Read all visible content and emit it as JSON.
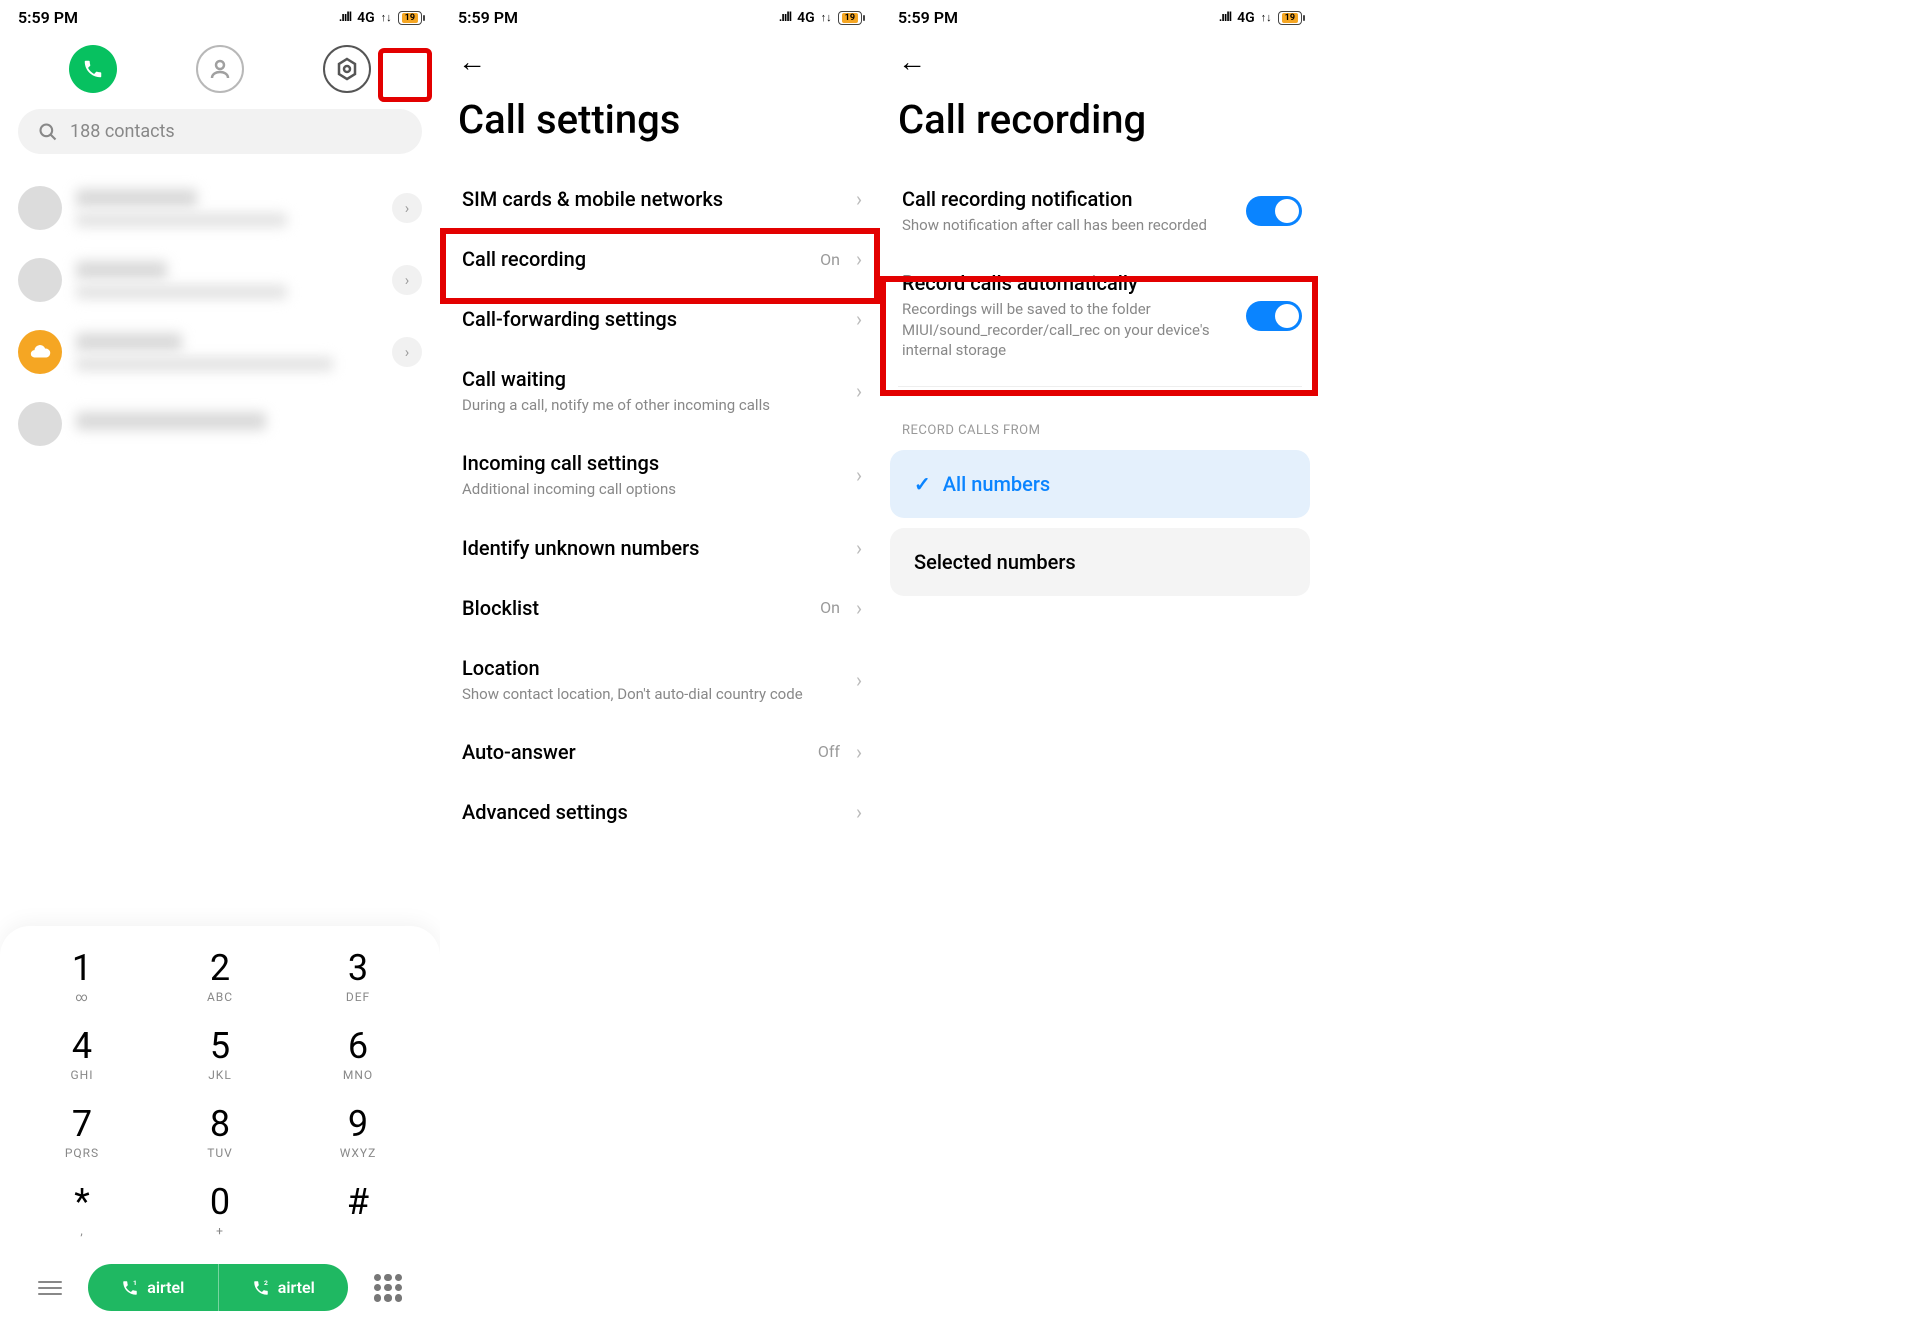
{
  "status": {
    "time": "5:59 PM",
    "network": "4G",
    "battery_pct": "19"
  },
  "screen1": {
    "search_placeholder": "188 contacts",
    "dialpad": [
      {
        "num": "1",
        "let": "∞"
      },
      {
        "num": "2",
        "let": "ABC"
      },
      {
        "num": "3",
        "let": "DEF"
      },
      {
        "num": "4",
        "let": "GHI"
      },
      {
        "num": "5",
        "let": "JKL"
      },
      {
        "num": "6",
        "let": "MNO"
      },
      {
        "num": "7",
        "let": "PQRS"
      },
      {
        "num": "8",
        "let": "TUV"
      },
      {
        "num": "9",
        "let": "WXYZ"
      },
      {
        "num": "*",
        "let": ","
      },
      {
        "num": "0",
        "let": "+"
      },
      {
        "num": "#",
        "let": ""
      }
    ],
    "sim1": "airtel",
    "sim2": "airtel"
  },
  "screen2": {
    "title": "Call settings",
    "items": [
      {
        "title": "SIM cards & mobile networks",
        "desc": "",
        "val": ""
      },
      {
        "title": "Call recording",
        "desc": "",
        "val": "On"
      },
      {
        "title": "Call-forwarding settings",
        "desc": "",
        "val": ""
      },
      {
        "title": "Call waiting",
        "desc": "During a call, notify me of other incoming calls",
        "val": ""
      },
      {
        "title": "Incoming call settings",
        "desc": "Additional incoming call options",
        "val": ""
      },
      {
        "title": "Identify unknown numbers",
        "desc": "",
        "val": ""
      },
      {
        "title": "Blocklist",
        "desc": "",
        "val": "On"
      },
      {
        "title": "Location",
        "desc": "Show contact location, Don't auto-dial country code",
        "val": ""
      },
      {
        "title": "Auto-answer",
        "desc": "",
        "val": "Off"
      },
      {
        "title": "Advanced settings",
        "desc": "",
        "val": ""
      }
    ]
  },
  "screen3": {
    "title": "Call recording",
    "toggles": [
      {
        "title": "Call recording notification",
        "desc": "Show notification after call has been recorded"
      },
      {
        "title": "Record calls automatically",
        "desc": "Recordings will be saved to the folder MIUI/sound_recorder/call_rec on your device's internal storage"
      }
    ],
    "section_header": "RECORD CALLS FROM",
    "options": [
      {
        "label": "All numbers",
        "selected": true
      },
      {
        "label": "Selected numbers",
        "selected": false
      }
    ]
  }
}
